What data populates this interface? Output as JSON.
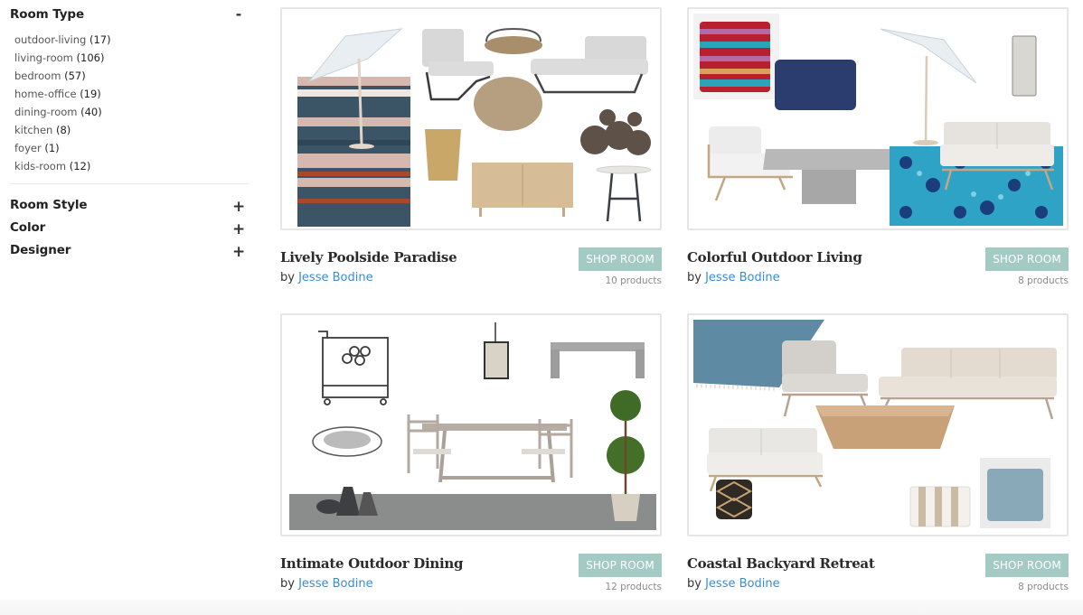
{
  "sidebar": {
    "room_type": {
      "title": "Room Type",
      "toggle": "-",
      "items": [
        {
          "label": "outdoor-living",
          "count": "(17)"
        },
        {
          "label": "living-room",
          "count": "(106)"
        },
        {
          "label": "bedroom",
          "count": "(57)"
        },
        {
          "label": "home-office",
          "count": "(19)"
        },
        {
          "label": "dining-room",
          "count": "(40)"
        },
        {
          "label": "kitchen",
          "count": "(8)"
        },
        {
          "label": "foyer",
          "count": "(1)"
        },
        {
          "label": "kids-room",
          "count": "(12)"
        }
      ]
    },
    "room_style": {
      "title": "Room Style",
      "toggle": "+"
    },
    "color": {
      "title": "Color",
      "toggle": "+"
    },
    "designer": {
      "title": "Designer",
      "toggle": "+"
    }
  },
  "rooms": [
    {
      "title": "Lively Poolside Paradise",
      "by": "by",
      "designer": "Jesse Bodine",
      "button": "SHOP ROOM",
      "products": "10 products",
      "image": "moodboard: striped rug, patio umbrella, lounge chair, round tray, double chaise, wicker pouf, planter, wall decor discs, sideboard, side table"
    },
    {
      "title": "Colorful Outdoor Living",
      "by": "by",
      "designer": "Jesse Bodine",
      "button": "SHOP ROOM",
      "products": "8 products",
      "image": "moodboard: striped pillow, navy pillow, patio umbrella, wall sconce, lounge chair, concrete coffee table, loveseat, blue tile rug"
    },
    {
      "title": "Intimate Outdoor Dining",
      "by": "by",
      "designer": "Jesse Bodine",
      "button": "SHOP ROOM",
      "products": "12 products",
      "image": "moodboard: bar cart, pendant lantern, concrete bench, wire bowl, dining table with chairs, topiary, vases, gray rug"
    },
    {
      "title": "Coastal Backyard Retreat",
      "by": "by",
      "designer": "Jesse Bodine",
      "button": "SHOP ROOM",
      "products": "8 products",
      "image": "moodboard: blue rug, lounge chair, sofa, wood coffee table, loveseat, geometric stool, striped pillow, blue pillow"
    }
  ],
  "colors": {
    "accent_button": "#a3cbc3",
    "link": "#3a8dd0",
    "card_border": "#e6e6e6"
  }
}
